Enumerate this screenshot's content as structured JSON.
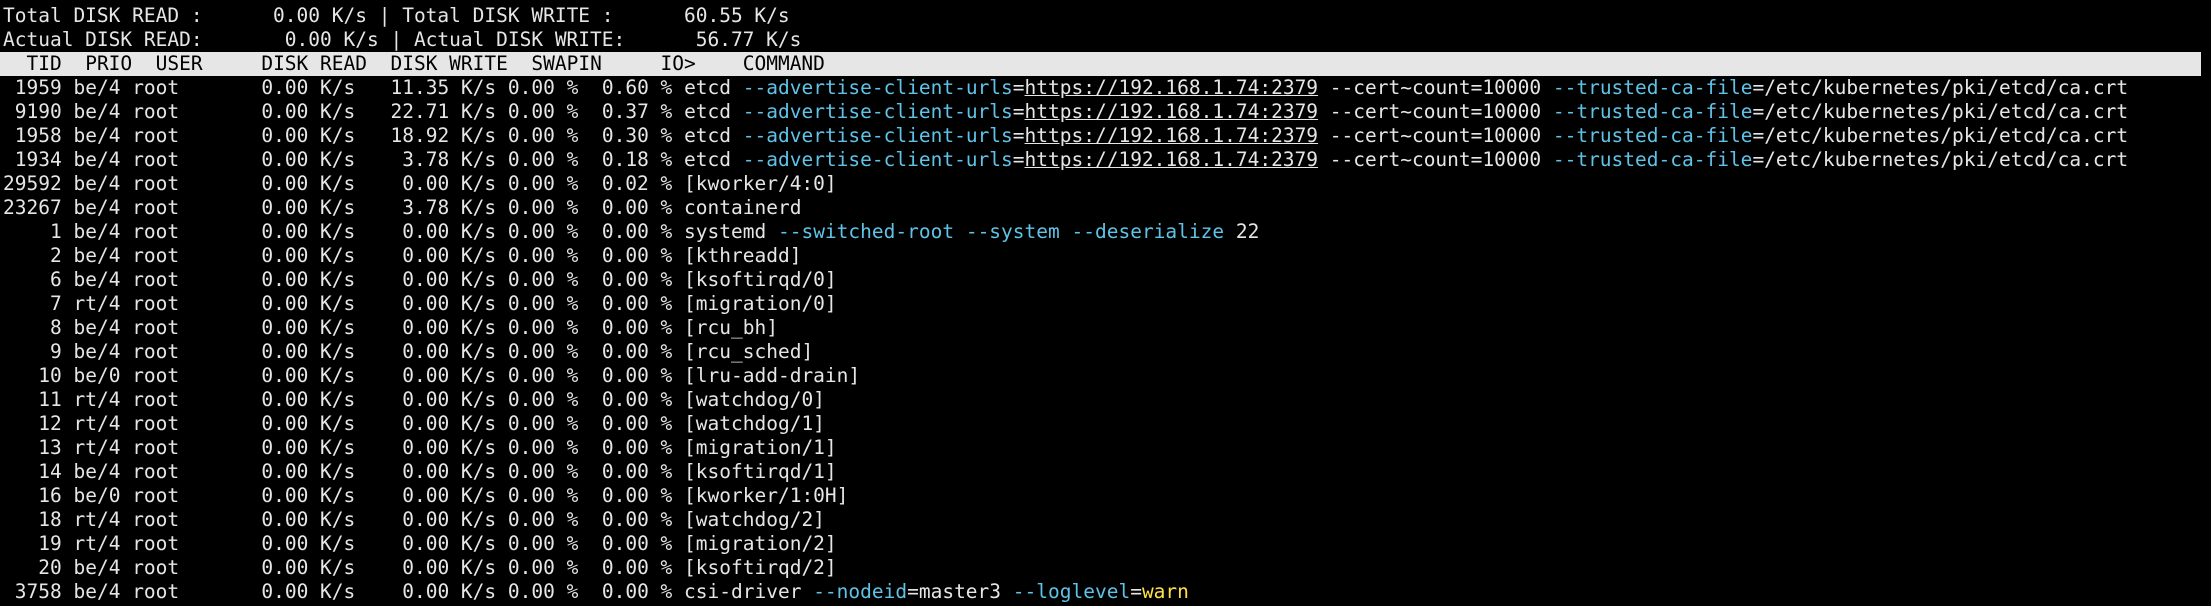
{
  "summary": {
    "total_read_label": "Total DISK READ :",
    "total_read_value": "0.00 K/s",
    "total_write_label": "Total DISK WRITE :",
    "total_write_value": "60.55 K/s",
    "actual_read_label": "Actual DISK READ:",
    "actual_read_value": "0.00 K/s",
    "actual_write_label": "Actual DISK WRITE:",
    "actual_write_value": "56.77 K/s"
  },
  "header": {
    "tid": "TID",
    "prio": "PRIO",
    "user": "USER",
    "disk_read": "DISK READ",
    "disk_write": "DISK WRITE",
    "swapin": "SWAPIN",
    "io": "IO>",
    "command": "COMMAND"
  },
  "colors": {
    "option": "#5fc3e8",
    "value": "#ffe24a",
    "header_bg": "#e6e6e6",
    "background": "#000000"
  },
  "rows": [
    {
      "tid": "1959",
      "prio": "be/4",
      "user": "root",
      "read": "0.00 K/s",
      "write": "11.35 K/s",
      "swapin": "0.00 %",
      "io": "0.60 %",
      "cmd": [
        {
          "t": "etcd "
        },
        {
          "t": "--advertise-client-urls",
          "k": "opt"
        },
        {
          "t": "="
        },
        {
          "t": "https://192.168.1.74:2379",
          "k": "url"
        },
        {
          "t": " --cert~count=10000 "
        },
        {
          "t": "--trusted-ca-file",
          "k": "opt"
        },
        {
          "t": "=/etc/kubernetes/pki/etcd/ca.crt"
        }
      ]
    },
    {
      "tid": "9190",
      "prio": "be/4",
      "user": "root",
      "read": "0.00 K/s",
      "write": "22.71 K/s",
      "swapin": "0.00 %",
      "io": "0.37 %",
      "cmd": [
        {
          "t": "etcd "
        },
        {
          "t": "--advertise-client-urls",
          "k": "opt"
        },
        {
          "t": "="
        },
        {
          "t": "https://192.168.1.74:2379",
          "k": "url"
        },
        {
          "t": " --cert~count=10000 "
        },
        {
          "t": "--trusted-ca-file",
          "k": "opt"
        },
        {
          "t": "=/etc/kubernetes/pki/etcd/ca.crt"
        }
      ]
    },
    {
      "tid": "1958",
      "prio": "be/4",
      "user": "root",
      "read": "0.00 K/s",
      "write": "18.92 K/s",
      "swapin": "0.00 %",
      "io": "0.30 %",
      "cmd": [
        {
          "t": "etcd "
        },
        {
          "t": "--advertise-client-urls",
          "k": "opt"
        },
        {
          "t": "="
        },
        {
          "t": "https://192.168.1.74:2379",
          "k": "url"
        },
        {
          "t": " --cert~count=10000 "
        },
        {
          "t": "--trusted-ca-file",
          "k": "opt"
        },
        {
          "t": "=/etc/kubernetes/pki/etcd/ca.crt"
        }
      ]
    },
    {
      "tid": "1934",
      "prio": "be/4",
      "user": "root",
      "read": "0.00 K/s",
      "write": "3.78 K/s",
      "swapin": "0.00 %",
      "io": "0.18 %",
      "cmd": [
        {
          "t": "etcd "
        },
        {
          "t": "--advertise-client-urls",
          "k": "opt"
        },
        {
          "t": "="
        },
        {
          "t": "https://192.168.1.74:2379",
          "k": "url"
        },
        {
          "t": " --cert~count=10000 "
        },
        {
          "t": "--trusted-ca-file",
          "k": "opt"
        },
        {
          "t": "=/etc/kubernetes/pki/etcd/ca.crt"
        }
      ]
    },
    {
      "tid": "29592",
      "prio": "be/4",
      "user": "root",
      "read": "0.00 K/s",
      "write": "0.00 K/s",
      "swapin": "0.00 %",
      "io": "0.02 %",
      "cmd": [
        {
          "t": "[kworker/4:0]"
        }
      ]
    },
    {
      "tid": "23267",
      "prio": "be/4",
      "user": "root",
      "read": "0.00 K/s",
      "write": "3.78 K/s",
      "swapin": "0.00 %",
      "io": "0.00 %",
      "cmd": [
        {
          "t": "containerd"
        }
      ]
    },
    {
      "tid": "1",
      "prio": "be/4",
      "user": "root",
      "read": "0.00 K/s",
      "write": "0.00 K/s",
      "swapin": "0.00 %",
      "io": "0.00 %",
      "cmd": [
        {
          "t": "systemd "
        },
        {
          "t": "--switched-root",
          "k": "opt"
        },
        {
          "t": " "
        },
        {
          "t": "--system",
          "k": "opt"
        },
        {
          "t": " "
        },
        {
          "t": "--deserialize",
          "k": "opt"
        },
        {
          "t": " 22"
        }
      ]
    },
    {
      "tid": "2",
      "prio": "be/4",
      "user": "root",
      "read": "0.00 K/s",
      "write": "0.00 K/s",
      "swapin": "0.00 %",
      "io": "0.00 %",
      "cmd": [
        {
          "t": "[kthreadd]"
        }
      ]
    },
    {
      "tid": "6",
      "prio": "be/4",
      "user": "root",
      "read": "0.00 K/s",
      "write": "0.00 K/s",
      "swapin": "0.00 %",
      "io": "0.00 %",
      "cmd": [
        {
          "t": "[ksoftirqd/0]"
        }
      ]
    },
    {
      "tid": "7",
      "prio": "rt/4",
      "user": "root",
      "read": "0.00 K/s",
      "write": "0.00 K/s",
      "swapin": "0.00 %",
      "io": "0.00 %",
      "cmd": [
        {
          "t": "[migration/0]"
        }
      ]
    },
    {
      "tid": "8",
      "prio": "be/4",
      "user": "root",
      "read": "0.00 K/s",
      "write": "0.00 K/s",
      "swapin": "0.00 %",
      "io": "0.00 %",
      "cmd": [
        {
          "t": "[rcu_bh]"
        }
      ]
    },
    {
      "tid": "9",
      "prio": "be/4",
      "user": "root",
      "read": "0.00 K/s",
      "write": "0.00 K/s",
      "swapin": "0.00 %",
      "io": "0.00 %",
      "cmd": [
        {
          "t": "[rcu_sched]"
        }
      ]
    },
    {
      "tid": "10",
      "prio": "be/0",
      "user": "root",
      "read": "0.00 K/s",
      "write": "0.00 K/s",
      "swapin": "0.00 %",
      "io": "0.00 %",
      "cmd": [
        {
          "t": "[lru-add-drain]"
        }
      ]
    },
    {
      "tid": "11",
      "prio": "rt/4",
      "user": "root",
      "read": "0.00 K/s",
      "write": "0.00 K/s",
      "swapin": "0.00 %",
      "io": "0.00 %",
      "cmd": [
        {
          "t": "[watchdog/0]"
        }
      ]
    },
    {
      "tid": "12",
      "prio": "rt/4",
      "user": "root",
      "read": "0.00 K/s",
      "write": "0.00 K/s",
      "swapin": "0.00 %",
      "io": "0.00 %",
      "cmd": [
        {
          "t": "[watchdog/1]"
        }
      ]
    },
    {
      "tid": "13",
      "prio": "rt/4",
      "user": "root",
      "read": "0.00 K/s",
      "write": "0.00 K/s",
      "swapin": "0.00 %",
      "io": "0.00 %",
      "cmd": [
        {
          "t": "[migration/1]"
        }
      ]
    },
    {
      "tid": "14",
      "prio": "be/4",
      "user": "root",
      "read": "0.00 K/s",
      "write": "0.00 K/s",
      "swapin": "0.00 %",
      "io": "0.00 %",
      "cmd": [
        {
          "t": "[ksoftirqd/1]"
        }
      ]
    },
    {
      "tid": "16",
      "prio": "be/0",
      "user": "root",
      "read": "0.00 K/s",
      "write": "0.00 K/s",
      "swapin": "0.00 %",
      "io": "0.00 %",
      "cmd": [
        {
          "t": "[kworker/1:0H]"
        }
      ]
    },
    {
      "tid": "18",
      "prio": "rt/4",
      "user": "root",
      "read": "0.00 K/s",
      "write": "0.00 K/s",
      "swapin": "0.00 %",
      "io": "0.00 %",
      "cmd": [
        {
          "t": "[watchdog/2]"
        }
      ]
    },
    {
      "tid": "19",
      "prio": "rt/4",
      "user": "root",
      "read": "0.00 K/s",
      "write": "0.00 K/s",
      "swapin": "0.00 %",
      "io": "0.00 %",
      "cmd": [
        {
          "t": "[migration/2]"
        }
      ]
    },
    {
      "tid": "20",
      "prio": "be/4",
      "user": "root",
      "read": "0.00 K/s",
      "write": "0.00 K/s",
      "swapin": "0.00 %",
      "io": "0.00 %",
      "cmd": [
        {
          "t": "[ksoftirqd/2]"
        }
      ]
    },
    {
      "tid": "3758",
      "prio": "be/4",
      "user": "root",
      "read": "0.00 K/s",
      "write": "0.00 K/s",
      "swapin": "0.00 %",
      "io": "0.00 %",
      "cmd": [
        {
          "t": "csi-driver "
        },
        {
          "t": "--nodeid",
          "k": "opt"
        },
        {
          "t": "=master3 "
        },
        {
          "t": "--loglevel",
          "k": "opt"
        },
        {
          "t": "="
        },
        {
          "t": "warn",
          "k": "val"
        }
      ]
    }
  ]
}
